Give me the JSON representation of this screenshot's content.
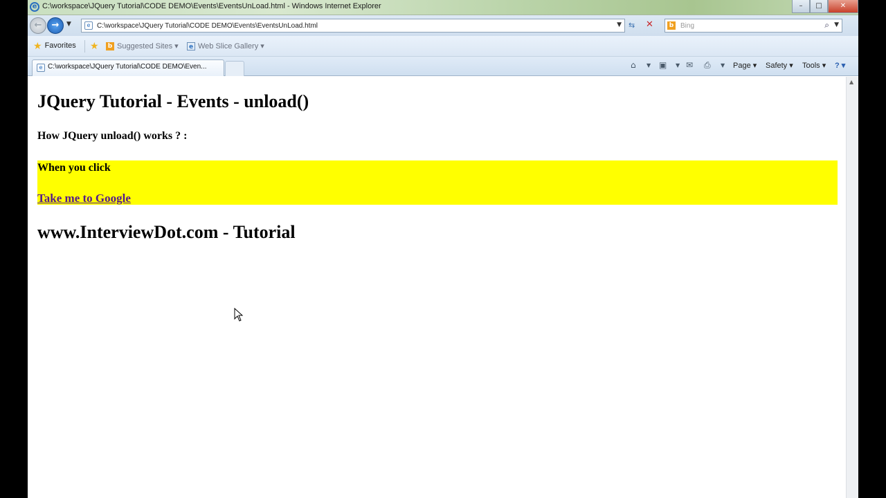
{
  "window": {
    "title": "C:\\workspace\\JQuery Tutorial\\CODE DEMO\\Events\\EventsUnLoad.html - Windows Internet Explorer",
    "icon": "ie-icon",
    "buttons": {
      "minimize": "–",
      "maximize": "□",
      "close": "✕"
    }
  },
  "address_bar": {
    "url": "C:\\workspace\\JQuery Tutorial\\CODE DEMO\\Events\\EventsUnLoad.html",
    "compat_icon": "⇆",
    "stop_icon": "✕"
  },
  "search": {
    "placeholder": "Bing",
    "search_icon": "⌕"
  },
  "favorites_bar": {
    "favorites_label": "Favorites",
    "suggested_sites_label": "Suggested Sites ▾",
    "web_slice_label": "Web Slice Gallery ▾"
  },
  "tabs": [
    {
      "label": "C:\\workspace\\JQuery Tutorial\\CODE DEMO\\Even..."
    }
  ],
  "command_bar": {
    "page_label": "Page ▾",
    "safety_label": "Safety ▾",
    "tools_label": "Tools ▾",
    "help_label": "? ▾"
  },
  "page": {
    "heading": "JQuery Tutorial - Events - unload()",
    "subheading": "How JQuery unload() works ? :",
    "box_text": "When you click",
    "link_text": "Take me to Google",
    "footer_heading": "www.InterviewDot.com - Tutorial"
  },
  "colors": {
    "highlight": "#ffff00",
    "link": "#551a8b"
  }
}
